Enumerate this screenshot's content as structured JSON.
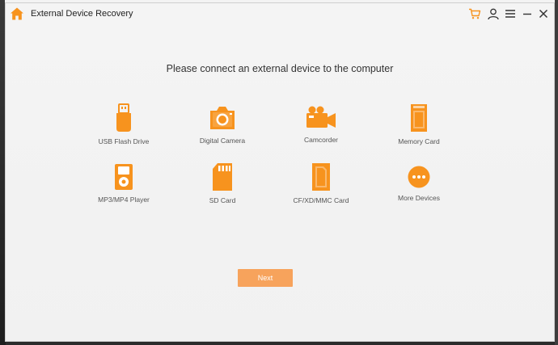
{
  "window": {
    "title": "External Device Recovery"
  },
  "toolbar_icons": [
    "home-icon",
    "cart-icon",
    "user-icon",
    "menu-icon",
    "minimize-icon",
    "close-icon"
  ],
  "heading": "Please connect an external device to the computer",
  "devices": [
    {
      "label": "USB Flash Drive",
      "icon": "usb-flash-drive-icon"
    },
    {
      "label": "Digital Camera",
      "icon": "digital-camera-icon"
    },
    {
      "label": "Camcorder",
      "icon": "camcorder-icon"
    },
    {
      "label": "Memory Card",
      "icon": "memory-card-icon"
    },
    {
      "label": "MP3/MP4 Player",
      "icon": "mp3-player-icon"
    },
    {
      "label": "SD Card",
      "icon": "sd-card-icon"
    },
    {
      "label": "CF/XD/MMC Card",
      "icon": "cf-card-icon"
    },
    {
      "label": "More Devices",
      "icon": "more-devices-icon"
    }
  ],
  "next_label": "Next",
  "colors": {
    "accent": "#f7931e",
    "button": "#f7a35c",
    "background": "#f2f2f2"
  }
}
